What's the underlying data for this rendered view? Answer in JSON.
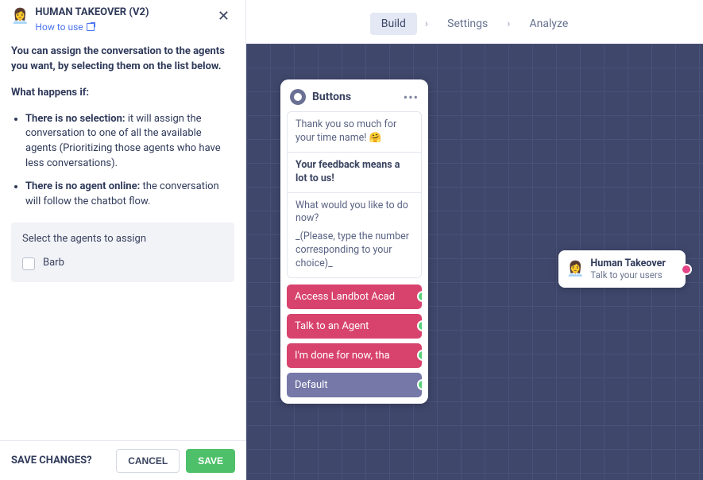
{
  "nav": {
    "tabs": [
      "Build",
      "Settings",
      "Analyze"
    ],
    "active": 0,
    "sep": "›"
  },
  "panel": {
    "emoji": "👩‍💼",
    "title": "HUMAN TAKEOVER (V2)",
    "how_to_use": "How to use",
    "intro": "You can assign the conversation to the agents you want, by selecting them on the list below.",
    "what_heading": "What happens if:",
    "bullets": [
      {
        "bold": "There is no selection:",
        "rest": " it will assign the conversation to one of all the available agents (Prioritizing those agents who have less conversations)."
      },
      {
        "bold": "There is no agent online:",
        "rest": " the conversation will follow the chatbot flow."
      }
    ],
    "agents_label": "Select the agents to assign",
    "agents": [
      {
        "name": "Barb",
        "checked": false
      }
    ],
    "footer": {
      "question": "SAVE CHANGES?",
      "cancel": "CANCEL",
      "save": "SAVE"
    }
  },
  "buttons_node": {
    "title": "Buttons",
    "msgs": [
      {
        "text": "Thank you so much for your time name! 🤗",
        "bold": false
      },
      {
        "text": "Your feedback means a lot to us!",
        "bold": true
      },
      {
        "text": "What would you like to do now?",
        "bold": false
      },
      {
        "text": "_(Please, type the number corresponding to your choice)_",
        "bold": false
      }
    ],
    "options": [
      {
        "label": "Access Landbot Acad",
        "style": "pink"
      },
      {
        "label": "Talk to an Agent",
        "style": "pink"
      },
      {
        "label": "I'm done for now, tha",
        "style": "pink"
      },
      {
        "label": "Default",
        "style": "purple"
      }
    ]
  },
  "ht_node": {
    "emoji": "👩‍💼",
    "title": "Human Takeover",
    "subtitle": "Talk to your users"
  }
}
